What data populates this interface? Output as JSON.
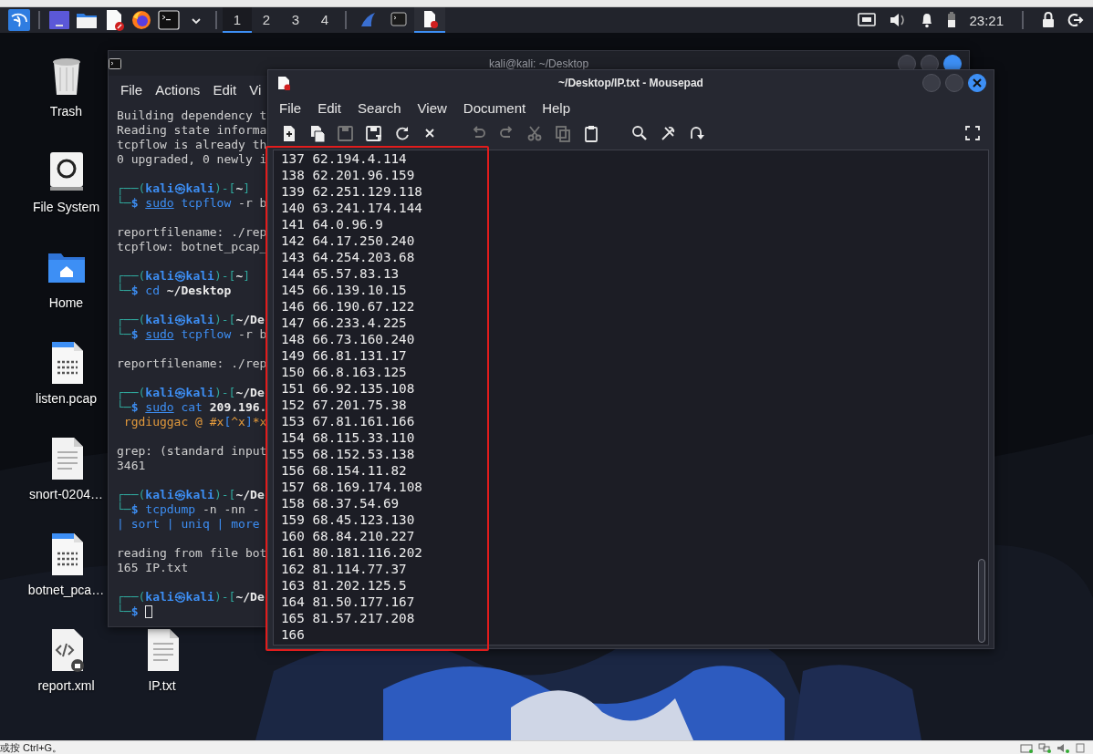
{
  "panel": {
    "launchers": [
      {
        "kind": "kali"
      },
      {
        "kind": "workspace"
      },
      {
        "kind": "files"
      },
      {
        "kind": "editor"
      },
      {
        "kind": "browser"
      },
      {
        "kind": "terminal"
      },
      {
        "kind": "caret"
      }
    ],
    "workspaces": [
      {
        "label": "1",
        "selected": true
      },
      {
        "label": "2",
        "selected": false
      },
      {
        "label": "3",
        "selected": false
      },
      {
        "label": "4",
        "selected": false
      }
    ],
    "tasks": [
      {
        "kind": "fin",
        "selected": false
      },
      {
        "kind": "terminal",
        "selected": false
      },
      {
        "kind": "editor",
        "selected": true
      }
    ],
    "clock": "23:21"
  },
  "desktop_icons": [
    {
      "label": "Trash",
      "kind": "trash"
    },
    {
      "label": "File System",
      "kind": "drive"
    },
    {
      "label": "Home",
      "kind": "home"
    },
    {
      "label": "listen.pcap",
      "kind": "binary"
    },
    {
      "label": "snort-0204…",
      "kind": "text"
    },
    {
      "label": "botnet_pca…",
      "kind": "binary"
    },
    {
      "label": "report.xml",
      "kind": "xml"
    },
    {
      "label": "IP.txt",
      "kind": "text"
    }
  ],
  "terminal": {
    "title": "kali@kali: ~/Desktop",
    "menu": [
      "File",
      "Actions",
      "Edit",
      "Vi"
    ],
    "lines": [
      {
        "segments": [
          {
            "text": "Building dependency t",
            "kind": "out"
          }
        ]
      },
      {
        "segments": [
          {
            "text": "Reading state informa",
            "kind": "out"
          }
        ]
      },
      {
        "segments": [
          {
            "text": "tcpflow is already th",
            "kind": "out"
          }
        ]
      },
      {
        "segments": [
          {
            "text": "0 upgraded, 0 newly i",
            "kind": "out"
          }
        ]
      },
      {
        "blank_before": true,
        "segments": [
          {
            "text": "┌──(",
            "kind": "frame"
          },
          {
            "text": "kali㉿kali",
            "kind": "user"
          },
          {
            "text": ")-[",
            "kind": "frame"
          },
          {
            "text": "~",
            "kind": "path"
          },
          {
            "text": "]",
            "kind": "frame"
          }
        ]
      },
      {
        "segments": [
          {
            "text": "└─",
            "kind": "frame"
          },
          {
            "text": "$ ",
            "kind": "user"
          },
          {
            "text": "sudo",
            "kind": "sudo"
          },
          {
            "text": " tcpflow",
            "kind": "cmd"
          },
          {
            "text": " -r b",
            "kind": "arg"
          }
        ]
      },
      {
        "blank_before": true,
        "segments": [
          {
            "text": "reportfilename: ./rep",
            "kind": "out"
          }
        ]
      },
      {
        "segments": [
          {
            "text": "tcpflow: botnet_pcap_",
            "kind": "out"
          }
        ]
      },
      {
        "blank_before": true,
        "segments": [
          {
            "text": "┌──(",
            "kind": "frame"
          },
          {
            "text": "kali㉿kali",
            "kind": "user"
          },
          {
            "text": ")-[",
            "kind": "frame"
          },
          {
            "text": "~",
            "kind": "path"
          },
          {
            "text": "]",
            "kind": "frame"
          }
        ]
      },
      {
        "segments": [
          {
            "text": "└─",
            "kind": "frame"
          },
          {
            "text": "$ ",
            "kind": "user"
          },
          {
            "text": "cd",
            "kind": "cmd"
          },
          {
            "text": " ~/Desktop",
            "kind": "bold"
          }
        ]
      },
      {
        "blank_before": true,
        "segments": [
          {
            "text": "┌──(",
            "kind": "frame"
          },
          {
            "text": "kali㉿kali",
            "kind": "user"
          },
          {
            "text": ")-[",
            "kind": "frame"
          },
          {
            "text": "~/De",
            "kind": "path"
          }
        ]
      },
      {
        "segments": [
          {
            "text": "└─",
            "kind": "frame"
          },
          {
            "text": "$ ",
            "kind": "user"
          },
          {
            "text": "sudo",
            "kind": "sudo"
          },
          {
            "text": " tcpflow",
            "kind": "cmd"
          },
          {
            "text": " -r b",
            "kind": "arg"
          }
        ]
      },
      {
        "blank_before": true,
        "segments": [
          {
            "text": "reportfilename: ./rep",
            "kind": "out"
          }
        ]
      },
      {
        "blank_before": true,
        "segments": [
          {
            "text": "┌──(",
            "kind": "frame"
          },
          {
            "text": "kali㉿kali",
            "kind": "user"
          },
          {
            "text": ")-[",
            "kind": "frame"
          },
          {
            "text": "~/De",
            "kind": "path"
          }
        ]
      },
      {
        "segments": [
          {
            "text": "└─",
            "kind": "frame"
          },
          {
            "text": "$ ",
            "kind": "user"
          },
          {
            "text": "sudo",
            "kind": "sudo"
          },
          {
            "text": " cat",
            "kind": "cmd"
          },
          {
            "text": " 209.196.",
            "kind": "bold"
          }
        ]
      },
      {
        "segments": [
          {
            "text": " rgdiuggac @ #x",
            "kind": "match"
          },
          {
            "text": "[",
            "kind": "bracket"
          },
          {
            "text": "^x",
            "kind": "match"
          },
          {
            "text": "]",
            "kind": "bracket"
          },
          {
            "text": "*x",
            "kind": "match"
          }
        ]
      },
      {
        "blank_before": true,
        "segments": [
          {
            "text": "grep: (standard input",
            "kind": "out"
          }
        ]
      },
      {
        "segments": [
          {
            "text": "3461",
            "kind": "out"
          }
        ]
      },
      {
        "blank_before": true,
        "segments": [
          {
            "text": "┌──(",
            "kind": "frame"
          },
          {
            "text": "kali㉿kali",
            "kind": "user"
          },
          {
            "text": ")-[",
            "kind": "frame"
          },
          {
            "text": "~/De",
            "kind": "path"
          }
        ]
      },
      {
        "segments": [
          {
            "text": "└─",
            "kind": "frame"
          },
          {
            "text": "$ ",
            "kind": "user"
          },
          {
            "text": "tcpdump",
            "kind": "cmd"
          },
          {
            "text": " -n -nn -",
            "kind": "arg"
          }
        ]
      },
      {
        "segments": [
          {
            "text": "| sort | uniq | more",
            "kind": "cmd"
          }
        ]
      },
      {
        "blank_before": true,
        "segments": [
          {
            "text": "reading from file bot",
            "kind": "out"
          }
        ]
      },
      {
        "segments": [
          {
            "text": "165 IP.txt",
            "kind": "out"
          }
        ]
      },
      {
        "blank_before": true,
        "segments": [
          {
            "text": "┌──(",
            "kind": "frame"
          },
          {
            "text": "kali㉿kali",
            "kind": "user"
          },
          {
            "text": ")-[",
            "kind": "frame"
          },
          {
            "text": "~/De",
            "kind": "path"
          }
        ]
      },
      {
        "cursor": true,
        "segments": [
          {
            "text": "└─",
            "kind": "frame"
          },
          {
            "text": "$ ",
            "kind": "user"
          }
        ]
      }
    ]
  },
  "mousepad": {
    "title": "~/Desktop/IP.txt - Mousepad",
    "menu": [
      "File",
      "Edit",
      "Search",
      "View",
      "Document",
      "Help"
    ],
    "lines": [
      "137 62.194.4.114",
      "138 62.201.96.159",
      "139 62.251.129.118",
      "140 63.241.174.144",
      "141 64.0.96.9",
      "142 64.17.250.240",
      "143 64.254.203.68",
      "144 65.57.83.13",
      "145 66.139.10.15",
      "146 66.190.67.122",
      "147 66.233.4.225",
      "148 66.73.160.240",
      "149 66.81.131.17",
      "150 66.8.163.125",
      "151 66.92.135.108",
      "152 67.201.75.38",
      "153 67.81.161.166",
      "154 68.115.33.110",
      "155 68.152.53.138",
      "156 68.154.11.82",
      "157 68.169.174.108",
      "158 68.37.54.69",
      "159 68.45.123.130",
      "160 68.84.210.227",
      "161 80.181.116.202",
      "162 81.114.77.37",
      "163 81.202.125.5",
      "164 81.50.177.167",
      "165 81.57.217.208",
      "166"
    ]
  },
  "host_status": {
    "hint": "或按 Ctrl+G。"
  }
}
